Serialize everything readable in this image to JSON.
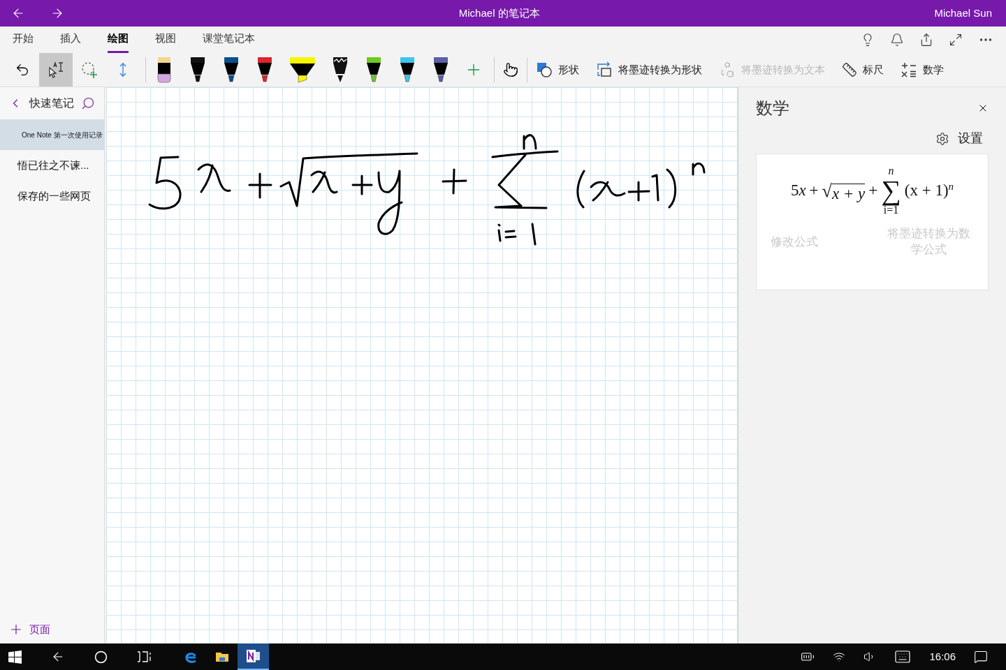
{
  "title_bar": {
    "title": "Michael 的笔记本",
    "user": "Michael Sun"
  },
  "ribbon_tabs": [
    {
      "label": "开始",
      "selected": false
    },
    {
      "label": "插入",
      "selected": false
    },
    {
      "label": "绘图",
      "selected": true
    },
    {
      "label": "视图",
      "selected": false
    },
    {
      "label": "课堂笔记本",
      "selected": false
    }
  ],
  "tool_buttons": [
    {
      "kind": "undo",
      "selected": false
    },
    {
      "kind": "type-select",
      "selected": true
    },
    {
      "kind": "lasso",
      "selected": false
    },
    {
      "kind": "space",
      "selected": false
    }
  ],
  "pens": [
    {
      "kind": "eraser",
      "color": "#f3d58f"
    },
    {
      "kind": "pen",
      "color": "#111111"
    },
    {
      "kind": "pen",
      "color": "#0b4f8a"
    },
    {
      "kind": "pen",
      "color": "#e0232b"
    },
    {
      "kind": "highlighter",
      "color": "#f5f500"
    },
    {
      "kind": "pencil",
      "color": "#111111"
    },
    {
      "kind": "pen",
      "color": "#6ccb1e"
    },
    {
      "kind": "pen",
      "color": "#3cc4ef"
    },
    {
      "kind": "galaxy",
      "color": "#5a5fa8"
    }
  ],
  "commands": [
    {
      "kind": "shapes",
      "label": "形状",
      "disabled": false
    },
    {
      "kind": "ink-to-shape",
      "label": "将墨迹转换为形状",
      "disabled": false
    },
    {
      "kind": "ink-to-text",
      "label": "将墨迹转换为文本",
      "disabled": true
    },
    {
      "kind": "ruler",
      "label": "标尺",
      "disabled": false
    },
    {
      "kind": "math",
      "label": "数学",
      "disabled": false
    }
  ],
  "sidebar": {
    "section": "快速笔记",
    "pages": [
      {
        "title": "One Note 第一次使用记录",
        "selected": true
      },
      {
        "title": "悟已往之不谏...",
        "selected": false
      },
      {
        "title": "保存的一些网页",
        "selected": false
      }
    ],
    "add_page": "页面"
  },
  "math_panel": {
    "title": "数学",
    "settings": "设置",
    "formula": {
      "coefficient": "5",
      "variable": "x",
      "op1": "+",
      "radical": "√",
      "radicand": "x + y",
      "op2": "+",
      "sum_symbol": "∑",
      "sum_upper": "n",
      "sum_lower": "i=1",
      "body": "(x + 1)",
      "exponent": "n"
    },
    "actions": [
      {
        "label": "修改公式",
        "disabled": true
      },
      {
        "label": "将墨迹转换为数学公式",
        "disabled": true
      }
    ]
  },
  "taskbar": {
    "apps": [
      {
        "kind": "edge",
        "selected": false
      },
      {
        "kind": "explorer",
        "selected": false
      },
      {
        "kind": "onenote",
        "selected": true
      }
    ],
    "time": "16:06"
  }
}
